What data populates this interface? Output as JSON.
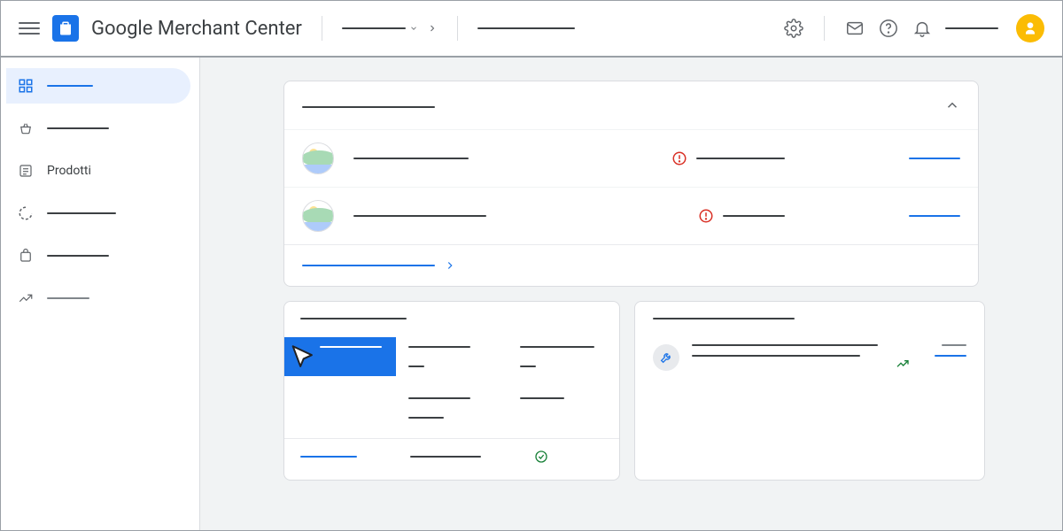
{
  "header": {
    "title": "Google Merchant Center"
  },
  "sidebar": {
    "items": [
      {
        "label": "",
        "active": true
      },
      {
        "label": ""
      },
      {
        "label": "Prodotti"
      },
      {
        "label": ""
      },
      {
        "label": ""
      },
      {
        "label": ""
      }
    ]
  },
  "colors": {
    "primary": "#1a73e8",
    "danger": "#d93025",
    "success": "#188038",
    "avatar": "#fbbc04"
  }
}
